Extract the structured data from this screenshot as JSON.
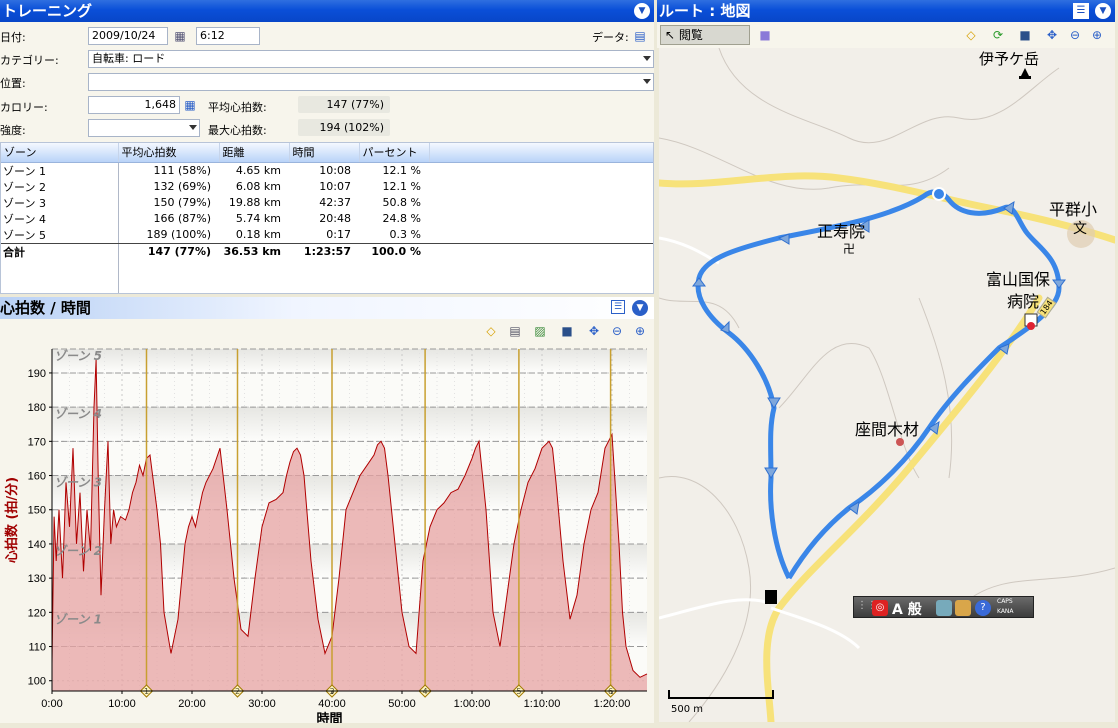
{
  "training": {
    "title": "トレーニング",
    "date_label": "日付:",
    "date_value": "2009/10/24",
    "time_value": "6:12",
    "data_label": "データ:",
    "category_label": "カテゴリー:",
    "category_value": "自転車: ロード",
    "location_label": "位置:",
    "location_value": "",
    "calories_label": "カロリー:",
    "calories_value": "1,648",
    "avg_hr_label": "平均心拍数:",
    "avg_hr_value": "147 (77%)",
    "intensity_label": "強度:",
    "intensity_value": "",
    "max_hr_label": "最大心拍数:",
    "max_hr_value": "194 (102%)"
  },
  "zone_table": {
    "headers": [
      "ゾーン",
      "平均心拍数",
      "距離",
      "時間",
      "パーセント"
    ],
    "rows": [
      [
        "ゾーン 1",
        "111 (58%)",
        "4.65 km",
        "10:08",
        "12.1 %"
      ],
      [
        "ゾーン 2",
        "132 (69%)",
        "6.08 km",
        "10:07",
        "12.1 %"
      ],
      [
        "ゾーン 3",
        "150 (79%)",
        "19.88 km",
        "42:37",
        "50.8 %"
      ],
      [
        "ゾーン 4",
        "166 (87%)",
        "5.74 km",
        "20:48",
        "24.8 %"
      ],
      [
        "ゾーン 5",
        "189 (100%)",
        "0.18 km",
        "0:17",
        "0.3 %"
      ]
    ],
    "total": [
      "合計",
      "147 (77%)",
      "36.53 km",
      "1:23:57",
      "100.0 %"
    ]
  },
  "hr_panel": {
    "title": "心拍数 / 時間",
    "ylabel": "心拍数 (拍/分)",
    "xlabel": "時間"
  },
  "route": {
    "title": "ルート : 地図",
    "browse_label": "閲覧",
    "scale_label": "500 m",
    "places": [
      "伊予ケ岳",
      "正寿院",
      "平群小",
      "文",
      "富山国保",
      "病院",
      "座間木材",
      "卍"
    ],
    "road_badge": "184"
  },
  "ime": {
    "caps": "CAPS",
    "kana": "KANA",
    "mode": "A 般"
  },
  "chart_data": {
    "type": "area",
    "ylabel": "心拍数 (拍/分)",
    "xlabel": "時間",
    "ylim": [
      97,
      197
    ],
    "xlim": [
      0,
      85
    ],
    "yticks": [
      100,
      110,
      120,
      130,
      140,
      150,
      160,
      170,
      180,
      190
    ],
    "xticks": [
      "0:00",
      "10:00",
      "20:00",
      "30:00",
      "40:00",
      "50:00",
      "1:00:00",
      "1:10:00",
      "1:20:00"
    ],
    "zones": [
      {
        "name": "ゾーン 1",
        "from": 110,
        "to": 120
      },
      {
        "name": "ゾーン 2",
        "from": 130,
        "to": 140
      },
      {
        "name": "ゾーン 3",
        "from": 150,
        "to": 160
      },
      {
        "name": "ゾーン 4",
        "from": 170,
        "to": 180
      },
      {
        "name": "ゾーン 5",
        "from": 190,
        "to": 197
      }
    ],
    "lap_markers": [
      "1",
      "2",
      "3",
      "4",
      "5",
      "6"
    ],
    "lap_times": [
      13.5,
      26.5,
      40,
      53.3,
      66.7,
      79.8
    ],
    "series": [
      {
        "x": [
          0,
          0.3,
          0.6,
          1,
          1.5,
          2,
          2.5,
          3,
          3.5,
          4,
          4.5,
          5,
          5.5,
          6,
          6.3,
          6.6,
          7,
          7.5,
          8,
          8.4,
          8.8,
          9.2,
          9.8,
          10.5,
          11,
          11.5,
          12,
          12.5,
          13,
          13.5,
          14,
          15,
          15.5,
          16,
          17,
          18,
          19,
          19.5,
          20,
          20.5,
          21,
          21.5,
          22,
          23,
          23.5,
          24,
          25,
          26,
          27,
          28,
          29,
          30,
          31,
          32,
          33,
          33.5,
          34,
          34.5,
          35,
          35.5,
          36,
          37,
          38,
          39,
          40,
          41,
          42,
          43,
          44,
          45,
          46,
          46.5,
          47,
          47.5,
          48,
          49,
          50,
          51,
          52,
          53,
          54,
          55,
          56,
          57,
          58,
          59,
          60,
          60.5,
          61,
          62,
          63,
          64,
          65,
          66,
          67,
          68,
          69,
          70,
          71,
          71.5,
          72,
          73,
          74,
          75,
          76,
          77,
          78,
          79,
          80,
          81,
          81.5,
          82,
          83,
          84,
          85
        ],
        "y": [
          105,
          148,
          135,
          150,
          130,
          158,
          145,
          168,
          140,
          155,
          132,
          150,
          138,
          180,
          194,
          160,
          125,
          150,
          170,
          140,
          150,
          145,
          148,
          147,
          150,
          155,
          158,
          163,
          160,
          165,
          166,
          150,
          140,
          120,
          108,
          118,
          140,
          145,
          148,
          145,
          150,
          155,
          158,
          162,
          165,
          168,
          150,
          130,
          115,
          113,
          130,
          145,
          152,
          153,
          155,
          160,
          164,
          167,
          168,
          166,
          160,
          135,
          118,
          108,
          113,
          130,
          150,
          155,
          160,
          163,
          166,
          169,
          170,
          168,
          160,
          140,
          120,
          110,
          108,
          135,
          145,
          150,
          152,
          155,
          156,
          160,
          165,
          168,
          170,
          150,
          120,
          110,
          125,
          140,
          150,
          158,
          162,
          168,
          170,
          168,
          158,
          135,
          118,
          125,
          140,
          150,
          155,
          168,
          172,
          140,
          120,
          110,
          103,
          101,
          102
        ]
      }
    ]
  }
}
